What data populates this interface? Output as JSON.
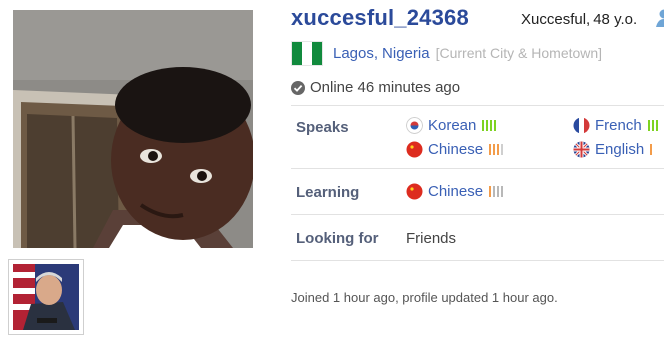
{
  "profile": {
    "username": "xuccesful_24368",
    "display_name": "Xuccesful",
    "age_text": "48 y.o.",
    "city": "Lagos",
    "country": "Nigeria",
    "location_note": "[Current City & Hometown]",
    "online_status": "Online 46 minutes ago",
    "joined_text": "Joined 1 hour ago, profile updated 1 hour ago."
  },
  "labels": {
    "speaks": "Speaks",
    "learning": "Learning",
    "looking_for": "Looking for"
  },
  "speaks": [
    {
      "name": "Korean",
      "level": "native",
      "icon": "korea-flag-icon"
    },
    {
      "name": "French",
      "level": "native",
      "icon": "france-flag-icon"
    },
    {
      "name": "Chinese",
      "level": "intermediate",
      "icon": "china-flag-icon"
    },
    {
      "name": "English",
      "level": "intermediate",
      "icon": "uk-flag-icon"
    }
  ],
  "learning": [
    {
      "name": "Chinese",
      "level": "beginner",
      "icon": "china-flag-icon"
    }
  ],
  "looking_for": "Friends",
  "colors": {
    "link": "#3a60b5",
    "username": "#2b4a9a",
    "label": "#55607a",
    "level_native": "#7ed321",
    "level_intermediate": "#f39c4a",
    "level_beginner": "#b8b8b8",
    "nigeria_green": "#118a3d"
  }
}
